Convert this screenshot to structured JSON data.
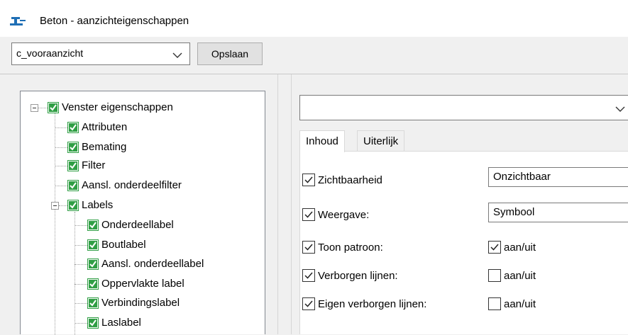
{
  "window": {
    "title": "Beton - aanzichteigenschappen"
  },
  "toolbar": {
    "view_select_value": "c_vooraanzicht",
    "save_label": "Opslaan"
  },
  "tree": {
    "root_label": "Venster eigenschappen",
    "items": [
      "Attributen",
      "Bemating",
      "Filter",
      "Aansl. onderdeelfilter"
    ],
    "labels_group": {
      "label": "Labels",
      "children": [
        "Onderdeellabel",
        "Boutlabel",
        "Aansl. onderdeellabel",
        "Oppervlakte label",
        "Verbindingslabel",
        "Laslabel"
      ]
    }
  },
  "properties": {
    "category_select_value": "",
    "tabs": [
      "Inhoud",
      "Uiterlijk"
    ],
    "active_tab": "Inhoud",
    "rows": [
      {
        "label": "Zichtbaarheid",
        "checked": true,
        "value": "Onzichtbaar"
      },
      {
        "label": "Weergave:",
        "checked": true,
        "value": "Symbool"
      },
      {
        "label": "Toon patroon:",
        "checked": true,
        "toggle_label": "aan/uit",
        "toggle_checked": true
      },
      {
        "label": "Verborgen lijnen:",
        "checked": true,
        "toggle_label": "aan/uit",
        "toggle_checked": false
      },
      {
        "label": "Eigen verborgen lijnen:",
        "checked": true,
        "toggle_label": "aan/uit",
        "toggle_checked": false
      }
    ]
  },
  "colors": {
    "tree_check_fill": "#2f9e44",
    "accent_icon": "#1f6fb5"
  }
}
